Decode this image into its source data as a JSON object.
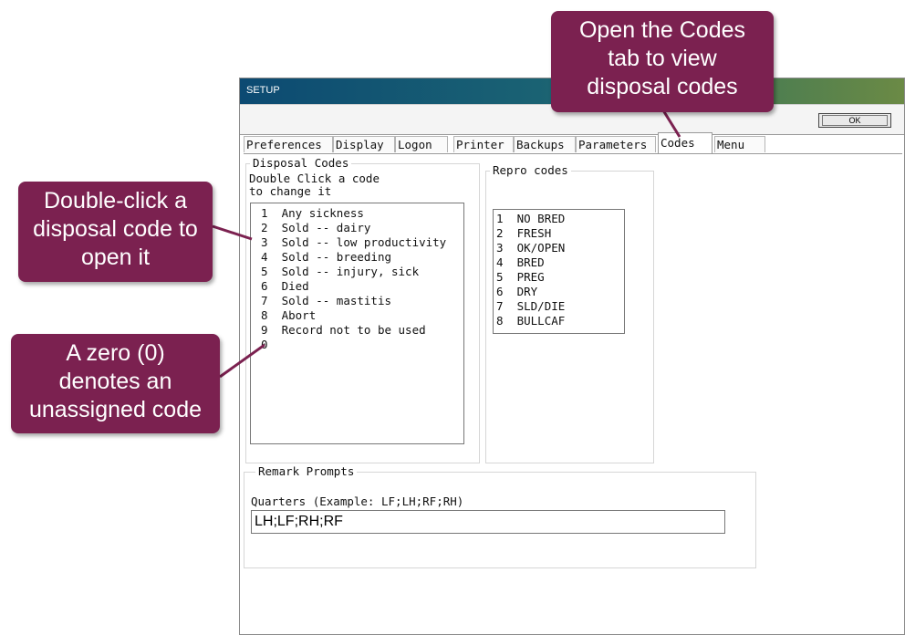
{
  "window": {
    "title": "SETUP",
    "ok_label": "OK"
  },
  "tabs": [
    "Preferences",
    "Display",
    "Logon",
    "Printer",
    "Backups",
    "Parameters",
    "Codes",
    "Menu"
  ],
  "active_tab": "Codes",
  "disposal": {
    "legend": "Disposal Codes",
    "hint_line1": "Double Click a code",
    "hint_line2": "to change it",
    "items": [
      {
        "num": "1",
        "label": "Any sickness"
      },
      {
        "num": "2",
        "label": "Sold -- dairy"
      },
      {
        "num": "3",
        "label": "Sold -- low productivity"
      },
      {
        "num": "4",
        "label": "Sold -- breeding"
      },
      {
        "num": "5",
        "label": "Sold -- injury, sick"
      },
      {
        "num": "6",
        "label": "Died"
      },
      {
        "num": "7",
        "label": "Sold -- mastitis"
      },
      {
        "num": "8",
        "label": "Abort"
      },
      {
        "num": "9",
        "label": "Record not to be used"
      },
      {
        "num": "0",
        "label": ""
      }
    ]
  },
  "repro": {
    "legend": "Repro codes",
    "items": [
      {
        "num": "1",
        "label": "NO BRED"
      },
      {
        "num": "2",
        "label": "FRESH"
      },
      {
        "num": "3",
        "label": "OK/OPEN"
      },
      {
        "num": "4",
        "label": "BRED"
      },
      {
        "num": "5",
        "label": "PREG"
      },
      {
        "num": "6",
        "label": "DRY"
      },
      {
        "num": "7",
        "label": "SLD/DIE"
      },
      {
        "num": "8",
        "label": "BULLCAF"
      }
    ]
  },
  "remark": {
    "legend": "Remark Prompts",
    "label": "Quarters (Example: LF;LH;RF;RH)",
    "value": "LH;LF;RH;RF"
  },
  "callouts": {
    "codes_tab": [
      "Open the Codes",
      "tab to view",
      "disposal codes"
    ],
    "double_click": [
      "Double-click a",
      "disposal code to",
      "open it"
    ],
    "zero": [
      "A zero (0)",
      "denotes an",
      "unassigned code"
    ]
  },
  "colors": {
    "callout_bg": "#7b2150",
    "title_gradient_start": "#0c4a72",
    "title_gradient_end": "#6b8a45"
  }
}
